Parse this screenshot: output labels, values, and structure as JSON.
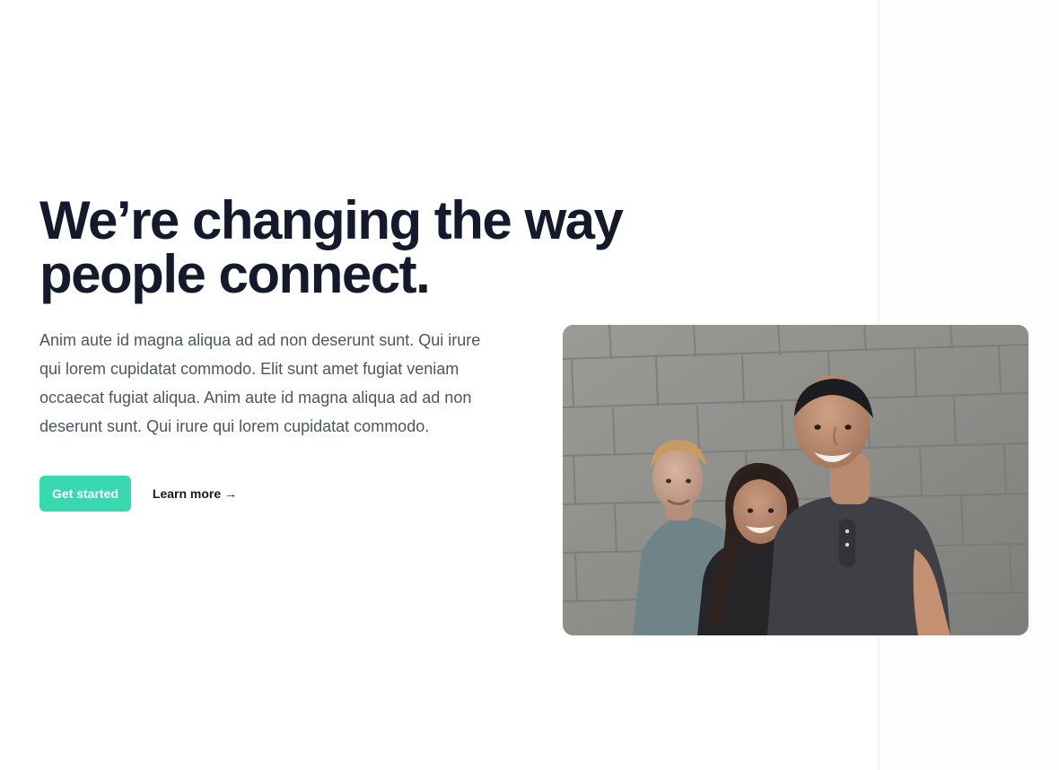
{
  "hero": {
    "title": "We’re changing the way people connect.",
    "description": "Anim aute id magna aliqua ad ad non deserunt sunt. Qui irure qui lorem cupidatat commodo. Elit sunt amet fugiat veniam occaecat fugiat aliqua. Anim aute id magna aliqua ad ad non deserunt sunt. Qui irure qui lorem cupidatat commodo.",
    "primary_cta": "Get started",
    "secondary_cta": "Learn more",
    "secondary_cta_arrow": "→"
  },
  "colors": {
    "accent": "#38d9b0",
    "heading": "#141a2b",
    "body_text": "#4b5563",
    "panel_border": "#eef8f6"
  },
  "image": {
    "subject": "group-photo-three-people"
  }
}
